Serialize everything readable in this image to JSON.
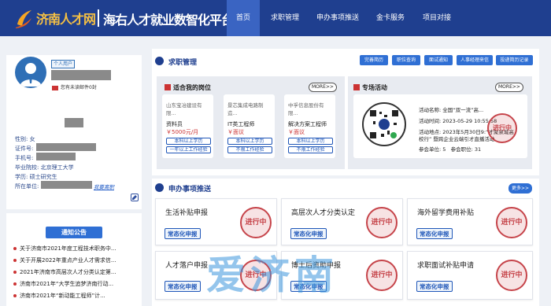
{
  "header": {
    "brand": "济南人才网",
    "platform": "海右人才就业数智化平台",
    "nav": [
      "首页",
      "求职管理",
      "申办事项推送",
      "金卡服务",
      "项目对接"
    ],
    "active": "首页"
  },
  "profile": {
    "tag": "个人用户",
    "unread": "您有未读邮件0封",
    "fields": {
      "gender": "性别: 女",
      "id": "证件号:",
      "phone": "手机号:",
      "school": "毕业院校: 北京理工大学",
      "degree": "学历: 硕士研究生",
      "unit": "所在单位:"
    },
    "leave": "我要离职"
  },
  "notices": {
    "title": "通知公告",
    "items": [
      "关于济南市2021年度工程技术职务中...",
      "关于开展2022年重点产业人才需求信...",
      "2021年济南市高层次人才分类认定第...",
      "济南市2021年“大学生追梦济南行动...",
      "济南市2021年“新动能工程师”计..."
    ]
  },
  "job_mgmt": {
    "title": "求职管理",
    "buttons": [
      "完善简历",
      "职位查询",
      "面试通知",
      "人事经理来信",
      "投递简历记录"
    ],
    "suitable": {
      "title": "适合我的岗位",
      "more": "MORE>>",
      "jobs": [
        {
          "company": "山东宝冶建设有限...",
          "position": "资料员",
          "salary": "￥5000元/月",
          "tags": [
            "本科以上学历",
            "一年以上工作经验"
          ]
        },
        {
          "company": "景芯集成电路制造...",
          "position": "IT类工程师",
          "salary": "￥面议",
          "tags": [
            "本科以上学历",
            "不限工作经验"
          ]
        },
        {
          "company": "中孚信息股份有限...",
          "position": "解决方案工程师",
          "salary": "￥面议",
          "tags": [
            "本科以上学历",
            "不限工作经验"
          ]
        }
      ]
    },
    "activity": {
      "title": "专场活动",
      "more": "MORE>>",
      "name": "活动名称: 全国“双一流”高...",
      "time": "活动时间: 2023-05-29 10:55:58",
      "place_1": "活动地点: 2023年5月30日9:“才聚泉城高",
      "place_2": "校行” 暨跨企业云端引才直播活动",
      "units_label": "参会单位:",
      "units": "5",
      "positions_label": "参会职位:",
      "positions": "31",
      "seal": "进行中"
    }
  },
  "services": {
    "title": "申办事项推送",
    "more": "更多>>",
    "btn_label": "常态化申报",
    "seal": "进行中",
    "cards": [
      "生活补贴申报",
      "高层次人才分类认定",
      "海外留学费用补贴",
      "人才落户申报",
      "博士后资助申报",
      "求职面试补贴申请"
    ]
  },
  "watermark": "爱济南",
  "colors": {
    "nav": "#1f3f8f",
    "nav_active": "#3a64c2",
    "accent": "#2f6fd4",
    "seal": "#c6444a"
  }
}
